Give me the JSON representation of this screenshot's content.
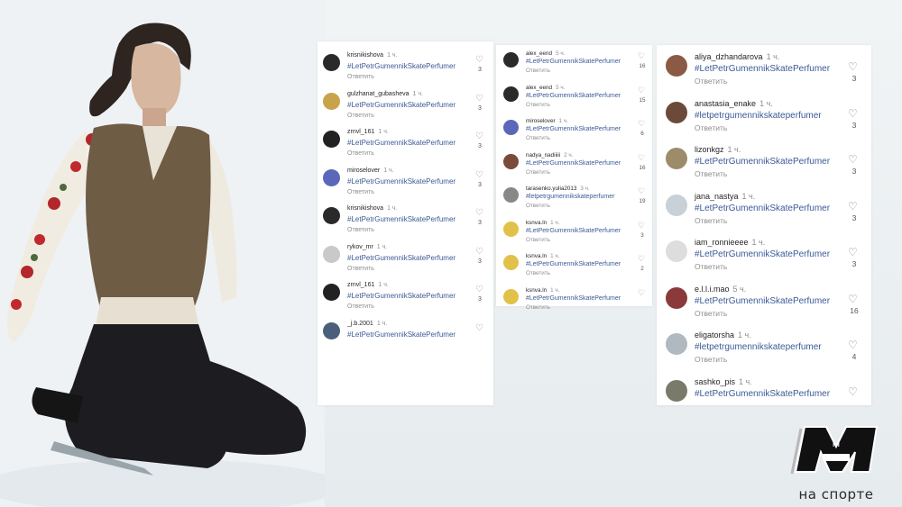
{
  "panel_left": [
    {
      "user": "krisnikishova",
      "time": "1 ч.",
      "tag": "#LetPetrGumennikSkatePerfumer",
      "reply": "Ответить",
      "likes": "3",
      "avatar": "#2a2a2a"
    },
    {
      "user": "gulzhanat_gubasheva",
      "time": "1 ч.",
      "tag": "#LetPetrGumennikSkatePerfumer",
      "reply": "Ответить",
      "likes": "3",
      "avatar": "#c7a44a"
    },
    {
      "user": "zrnvl_161",
      "time": "1 ч.",
      "tag": "#LetPetrGumennikSkatePerfumer",
      "reply": "Ответить",
      "likes": "3",
      "avatar": "#222222"
    },
    {
      "user": "miroselover",
      "time": "1 ч.",
      "tag": "#LetPetrGumennikSkatePerfumer",
      "reply": "Ответить",
      "likes": "3",
      "avatar": "#5b67b8"
    },
    {
      "user": "krisnikishova",
      "time": "1 ч.",
      "tag": "#LetPetrGumennikSkatePerfumer",
      "reply": "Ответить",
      "likes": "3",
      "avatar": "#2a2a2a"
    },
    {
      "user": "rykov_mr",
      "time": "1 ч.",
      "tag": "#LetPetrGumennikSkatePerfumer",
      "reply": "Ответить",
      "likes": "3",
      "avatar": "#c9c9c9"
    },
    {
      "user": "zrnvl_161",
      "time": "1 ч.",
      "tag": "#LetPetrGumennikSkatePerfumer",
      "reply": "Ответить",
      "likes": "3",
      "avatar": "#222222"
    },
    {
      "user": "_j.b.2001",
      "time": "1 ч.",
      "tag": "#LetPetrGumennikSkatePerfumer",
      "reply": "",
      "likes": "",
      "avatar": "#4a5f7a"
    }
  ],
  "panel_middle": [
    {
      "user": "alex_eend",
      "time": "5 ч.",
      "tag": "#LetPetrGumennikSkatePerfumer",
      "reply": "Ответить",
      "likes": "16",
      "avatar": "#2a2a2a"
    },
    {
      "user": "alex_eend",
      "time": "5 ч.",
      "tag": "#LetPetrGumennikSkatePerfumer",
      "reply": "Ответить",
      "likes": "15",
      "avatar": "#2a2a2a"
    },
    {
      "user": "miroselover",
      "time": "1 ч.",
      "tag": "#LetPetrGumennikSkatePerfumer",
      "reply": "Ответить",
      "likes": "6",
      "avatar": "#5b67b8"
    },
    {
      "user": "nadya_nadiiiii",
      "time": "2 ч.",
      "tag": "#LetPetrGumennikSkatePerfumer",
      "reply": "Ответить",
      "likes": "16",
      "avatar": "#7a4a3a"
    },
    {
      "user": "tarasenko.yulia2013",
      "time": "3 ч.",
      "tag": "#letpetrgumennikskateperfumer",
      "reply": "Ответить",
      "likes": "19",
      "avatar": "#888888"
    },
    {
      "user": "ksnva.ln",
      "time": "1 ч.",
      "tag": "#LetPetrGumennikSkatePerfumer",
      "reply": "Ответить",
      "likes": "3",
      "avatar": "#e2c14a"
    },
    {
      "user": "ksnva.ln",
      "time": "1 ч.",
      "tag": "#LetPetrGumennikSkatePerfumer",
      "reply": "Ответить",
      "likes": "2",
      "avatar": "#e2c14a"
    },
    {
      "user": "ksnva.ln",
      "time": "1 ч.",
      "tag": "#LetPetrGumennikSkatePerfumer",
      "reply": "Ответить",
      "likes": "",
      "avatar": "#e2c14a"
    }
  ],
  "panel_right": [
    {
      "user": "aliya_dzhandarova",
      "time": "1 ч.",
      "tag": "#LetPetrGumennikSkatePerfumer",
      "reply": "Ответить",
      "likes": "3",
      "avatar": "#8a5a45"
    },
    {
      "user": "anastasia_enake",
      "time": "1 ч.",
      "tag": "#letpetrgumennikskateperfumer",
      "reply": "Ответить",
      "likes": "3",
      "avatar": "#6b4a3a"
    },
    {
      "user": "lizonkgz",
      "time": "1 ч.",
      "tag": "#LetPetrGumennikSkatePerfumer",
      "reply": "Ответить",
      "likes": "3",
      "avatar": "#9c8c6a"
    },
    {
      "user": "jana_nastya",
      "time": "1 ч.",
      "tag": "#LetPetrGumennikSkatePerfumer",
      "reply": "Ответить",
      "likes": "3",
      "avatar": "#c8d0d8"
    },
    {
      "user": "iam_ronnieeee",
      "time": "1 ч.",
      "tag": "#LetPetrGumennikSkatePerfumer",
      "reply": "Ответить",
      "likes": "3",
      "avatar": "#dddddd"
    },
    {
      "user": "e.l.l.i.mao",
      "time": "5 ч.",
      "tag": "#LetPetrGumennikSkatePerfumer",
      "reply": "Ответить",
      "likes": "16",
      "avatar": "#8a3a3a"
    },
    {
      "user": "eligatorsha",
      "time": "1 ч.",
      "tag": "#letpetrgumennikskateperfumer",
      "reply": "Ответить",
      "likes": "4",
      "avatar": "#b0b8c0"
    },
    {
      "user": "sashko_pis",
      "time": "1 ч.",
      "tag": "#LetPetrGumennikSkatePerfumer",
      "reply": "",
      "likes": "",
      "avatar": "#7a7a6a"
    }
  ],
  "logo": {
    "text": "на спорте",
    "icon": "m-logo-icon"
  },
  "icons": {
    "like": "heart-icon"
  }
}
